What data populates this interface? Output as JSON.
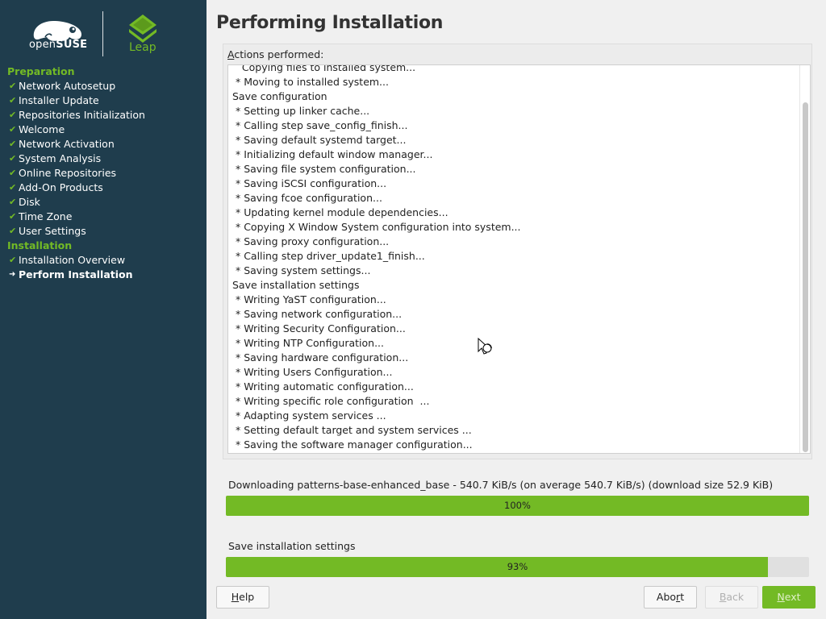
{
  "branding": {
    "product": "openSUSE",
    "product_open": "open",
    "product_suse": "SUSE",
    "edition": "Leap",
    "accent_color": "#73ba25",
    "sidebar_color": "#1f3d4d"
  },
  "sidebar": {
    "sections": [
      {
        "heading": "Preparation",
        "items": [
          {
            "label": "Network Autosetup",
            "status": "done"
          },
          {
            "label": "Installer Update",
            "status": "done"
          },
          {
            "label": "Repositories Initialization",
            "status": "done"
          },
          {
            "label": "Welcome",
            "status": "done"
          },
          {
            "label": "Network Activation",
            "status": "done"
          },
          {
            "label": "System Analysis",
            "status": "done"
          },
          {
            "label": "Online Repositories",
            "status": "done"
          },
          {
            "label": "Add-On Products",
            "status": "done"
          },
          {
            "label": "Disk",
            "status": "done"
          },
          {
            "label": "Time Zone",
            "status": "done"
          },
          {
            "label": "User Settings",
            "status": "done"
          }
        ]
      },
      {
        "heading": "Installation",
        "items": [
          {
            "label": "Installation Overview",
            "status": "done"
          },
          {
            "label": "Perform Installation",
            "status": "current"
          }
        ]
      }
    ]
  },
  "main": {
    "title": "Performing Installation",
    "log_label_prefix": "A",
    "log_label_rest": "ctions performed:",
    "log_lines": [
      "   Copying files to installed system...",
      " * Moving to installed system...",
      "Save configuration",
      " * Setting up linker cache...",
      " * Calling step save_config_finish...",
      " * Saving default systemd target...",
      " * Initializing default window manager...",
      " * Saving file system configuration...",
      " * Saving iSCSI configuration...",
      " * Saving fcoe configuration...",
      " * Updating kernel module dependencies...",
      " * Copying X Window System configuration into system...",
      " * Saving proxy configuration...",
      " * Calling step driver_update1_finish...",
      " * Saving system settings...",
      "Save installation settings",
      " * Writing YaST configuration...",
      " * Saving network configuration...",
      " * Writing Security Configuration...",
      " * Writing NTP Configuration...",
      " * Saving hardware configuration...",
      " * Writing Users Configuration...",
      " * Writing automatic configuration...",
      " * Writing specific role configuration  ...",
      " * Adapting system services ...",
      " * Setting default target and system services ...",
      " * Saving the software manager configuration..."
    ],
    "progress": [
      {
        "label": "Downloading patterns-base-enhanced_base - 540.7 KiB/s (on average 540.7 KiB/s) (download size 52.9 KiB)",
        "text": "100%",
        "value": 1.0
      },
      {
        "label": "Save installation settings",
        "text": "93%",
        "value": 0.93
      }
    ]
  },
  "buttons": {
    "help": {
      "mnemonic": "H",
      "rest": "elp"
    },
    "abort": {
      "pre": "Abo",
      "mnemonic": "r",
      "rest": "t"
    },
    "back": {
      "mnemonic": "B",
      "rest": "ack"
    },
    "next": {
      "mnemonic": "N",
      "rest": "ext"
    }
  }
}
